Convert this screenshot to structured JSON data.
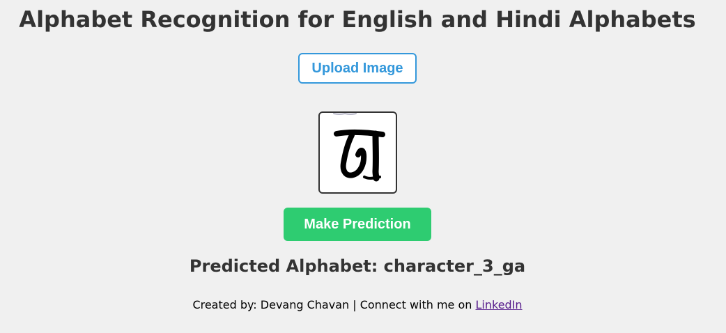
{
  "page": {
    "title": "Alphabet Recognition for English and Hindi Alphabets"
  },
  "upload": {
    "label": "Upload Image"
  },
  "preview": {
    "alt": "Uploaded character image"
  },
  "predict": {
    "label": "Make Prediction"
  },
  "result": {
    "prefix": "Predicted Alphabet: ",
    "value": "character_3_ga"
  },
  "footer": {
    "text": "Created by: Devang Chavan | Connect with me on ",
    "link_label": "LinkedIn"
  },
  "colors": {
    "background": "#f0f0f0",
    "upload_accent": "#3498db",
    "predict_accent": "#2ecc71",
    "text": "#333333",
    "link": "#551a8b"
  }
}
